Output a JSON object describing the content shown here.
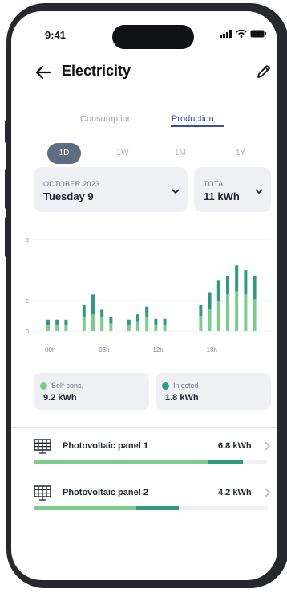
{
  "status": {
    "time": "9:41"
  },
  "header": {
    "title": "Electricity"
  },
  "tabs": [
    {
      "label": "Consumption",
      "active": false
    },
    {
      "label": "Production",
      "active": true
    }
  ],
  "periods": [
    {
      "label": "1D",
      "active": true
    },
    {
      "label": "1W",
      "active": false
    },
    {
      "label": "1M",
      "active": false
    },
    {
      "label": "1Y",
      "active": false
    }
  ],
  "date_select": {
    "caption": "OCTOBER 2023",
    "value": "Tuesday 9"
  },
  "total_select": {
    "caption": "TOTAL",
    "value": "11 kWh"
  },
  "chart_data": {
    "type": "bar",
    "stacked": true,
    "y_ticks": [
      "6",
      "2",
      "0"
    ],
    "x_ticks": [
      "00h",
      "06h",
      "12h",
      "18h"
    ],
    "ylim": [
      0,
      6
    ],
    "grid": true,
    "hours": [
      0,
      1,
      2,
      4,
      5,
      6,
      7,
      9,
      10,
      11,
      12,
      13,
      14,
      17,
      18,
      19,
      20,
      21,
      22,
      23
    ],
    "series": [
      {
        "name": "Self-cons.",
        "color": "#7dcb8c",
        "values": [
          0.4,
          0.4,
          0.4,
          0.9,
          1.1,
          0.9,
          0.5,
          0.4,
          0.6,
          0.9,
          0.4,
          0.4,
          0,
          1.0,
          1.4,
          2.0,
          2.4,
          2.6,
          2.4,
          2.1
        ]
      },
      {
        "name": "Injected",
        "color": "#2f9a80",
        "values": [
          0.35,
          0.35,
          0.35,
          0.8,
          1.3,
          0.5,
          0.45,
          0.35,
          0.5,
          0.7,
          0.4,
          0.4,
          0,
          0.7,
          1.1,
          1.3,
          1.2,
          1.7,
          1.6,
          1.5
        ]
      }
    ]
  },
  "legend": {
    "self": {
      "label": "Self-cons.",
      "value": "9.2 kWh",
      "color": "#7dcb8c"
    },
    "injected": {
      "label": "Injected",
      "value": "1.8 kWh",
      "color": "#2f9a80"
    }
  },
  "panels": [
    {
      "name": "Photovoltaic panel 1",
      "value": "6.8 kWh",
      "icon": "solar-panel-icon",
      "self_fraction": 0.745,
      "injected_fraction": 0.15
    },
    {
      "name": "Photovoltaic panel 2",
      "value": "4.2 kWh",
      "icon": "solar-panel-icon",
      "self_fraction": 0.44,
      "injected_fraction": 0.18
    }
  ],
  "colors": {
    "accent": "#3b4fa0",
    "self": "#7dcb8c",
    "injected": "#2f9a80"
  }
}
